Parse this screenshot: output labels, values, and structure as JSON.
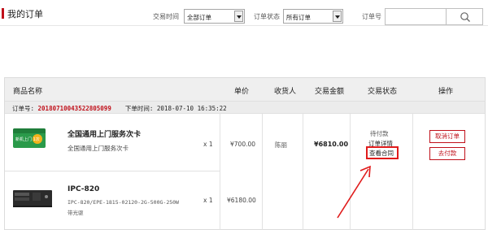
{
  "header": {
    "title": "我的订单",
    "filters": {
      "time_label": "交易时间",
      "time_value": "全部订单",
      "status_label": "订单状态",
      "status_value": "所有订单",
      "order_no_label": "订单号",
      "order_no_value": ""
    }
  },
  "table": {
    "columns": [
      "商品名称",
      "单价",
      "收货人",
      "交易金额",
      "交易状态",
      "操作"
    ]
  },
  "order": {
    "number_label": "订单号:",
    "number": "20180710043522805099",
    "time_label": "下单时间:",
    "time": "2018-07-10 16:35:22",
    "receiver": "陈丽",
    "amount": "¥6810.00",
    "status": {
      "payment": "待付款",
      "details_link": "订单详情",
      "contract_link": "查看合同"
    },
    "actions": {
      "cancel": "取消订单",
      "pay": "去付款"
    },
    "items": [
      {
        "name": "全国通用上门服务次卡",
        "subtitle": "全国通用上门服务次卡",
        "qty": "x 1",
        "price": "¥700.00",
        "thumb_text": "新机上门 1次",
        "icon": "service-card-image"
      },
      {
        "name": "IPC-820",
        "spec": "IPC-820/EPE-1815-02120-2G-500G-250W",
        "spec2": "带光驱",
        "qty": "x 1",
        "price": "¥6180.00",
        "icon": "industrial-pc-image"
      }
    ]
  },
  "colors": {
    "accent": "#c0101a",
    "annotation": "#e01b1b"
  }
}
